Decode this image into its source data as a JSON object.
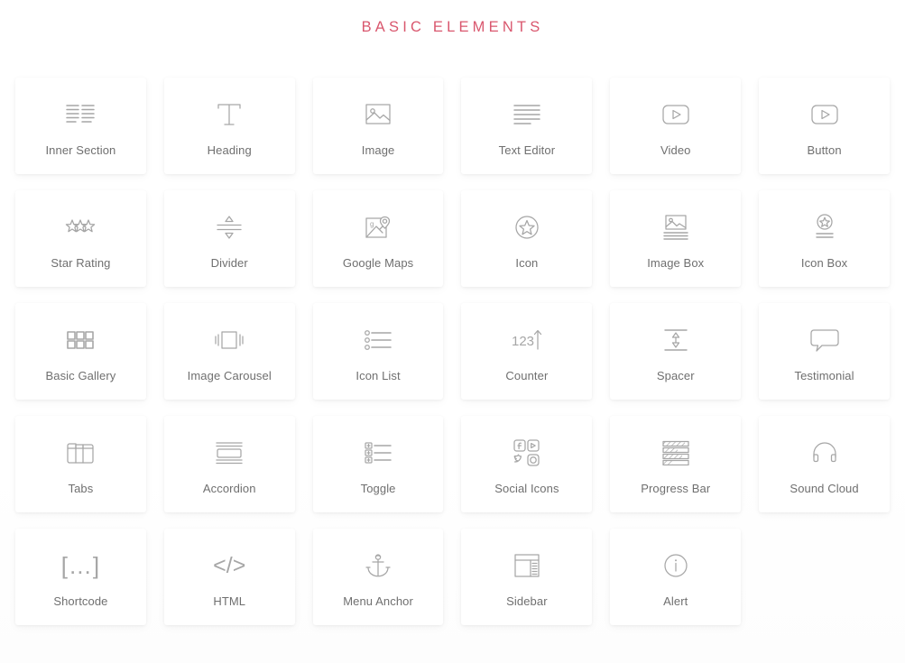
{
  "header": {
    "title": "BASIC ELEMENTS",
    "title_color": "#d9576e"
  },
  "theme": {
    "background": "#ffffff",
    "card_background": "#ffffff",
    "icon_color": "#a6a6a6",
    "label_color": "#6f6f6f"
  },
  "elements": [
    {
      "label": "Inner Section",
      "icon": "inner-section-icon"
    },
    {
      "label": "Heading",
      "icon": "heading-icon"
    },
    {
      "label": "Image",
      "icon": "image-icon"
    },
    {
      "label": "Text Editor",
      "icon": "text-editor-icon"
    },
    {
      "label": "Video",
      "icon": "video-play-icon"
    },
    {
      "label": "Button",
      "icon": "button-play-icon"
    },
    {
      "label": "Star Rating",
      "icon": "star-rating-icon"
    },
    {
      "label": "Divider",
      "icon": "divider-icon"
    },
    {
      "label": "Google Maps",
      "icon": "google-maps-icon"
    },
    {
      "label": "Icon",
      "icon": "star-circle-icon"
    },
    {
      "label": "Image Box",
      "icon": "image-box-icon"
    },
    {
      "label": "Icon Box",
      "icon": "icon-box-icon"
    },
    {
      "label": "Basic Gallery",
      "icon": "basic-gallery-icon"
    },
    {
      "label": "Image Carousel",
      "icon": "image-carousel-icon"
    },
    {
      "label": "Icon List",
      "icon": "icon-list-icon"
    },
    {
      "label": "Counter",
      "icon": "counter-icon"
    },
    {
      "label": "Spacer",
      "icon": "spacer-icon"
    },
    {
      "label": "Testimonial",
      "icon": "testimonial-icon"
    },
    {
      "label": "Tabs",
      "icon": "tabs-icon"
    },
    {
      "label": "Accordion",
      "icon": "accordion-icon"
    },
    {
      "label": "Toggle",
      "icon": "toggle-icon"
    },
    {
      "label": "Social Icons",
      "icon": "social-icons-icon"
    },
    {
      "label": "Progress Bar",
      "icon": "progress-bar-icon"
    },
    {
      "label": "Sound Cloud",
      "icon": "sound-cloud-icon"
    },
    {
      "label": "Shortcode",
      "icon": "shortcode-icon",
      "glyph": "[…]"
    },
    {
      "label": "HTML",
      "icon": "html-code-icon",
      "glyph": "</>"
    },
    {
      "label": "Menu Anchor",
      "icon": "anchor-icon"
    },
    {
      "label": "Sidebar",
      "icon": "sidebar-icon"
    },
    {
      "label": "Alert",
      "icon": "alert-info-icon"
    }
  ]
}
